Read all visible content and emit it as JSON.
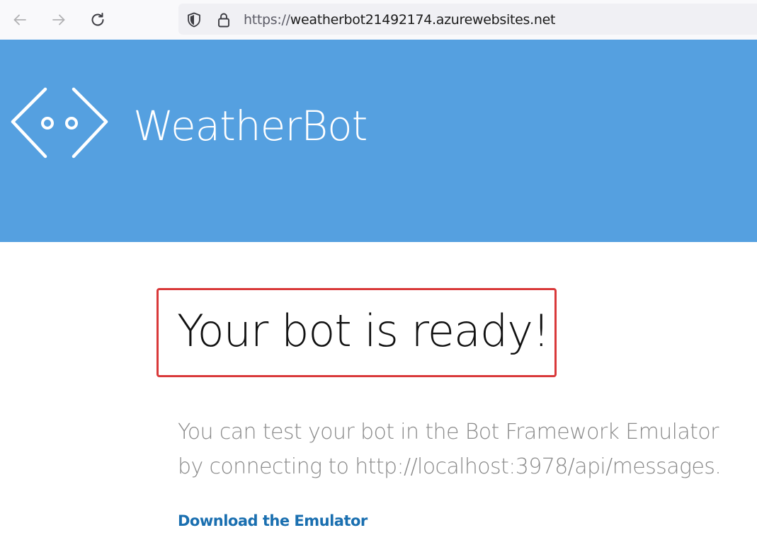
{
  "browser": {
    "url_scheme": "https://",
    "url_host": "weatherbot21492174.azurewebsites.net",
    "back_icon": "arrow-left-icon",
    "forward_icon": "arrow-right-icon",
    "reload_icon": "reload-icon",
    "tracking_icon": "shield-icon",
    "lock_icon": "lock-icon"
  },
  "header": {
    "bot_name": "WeatherBot",
    "logo_icon": "bot-face-icon",
    "background_color": "#55a0e0"
  },
  "main": {
    "title": "Your bot is ready!",
    "description_line1": "You can test your bot in the Bot Framework Emulator",
    "description_line2": "by connecting to http://localhost:3978/api/messages.",
    "download_link": "Download the Emulator",
    "highlight_color": "#d9393a",
    "link_color": "#1a6fb0"
  }
}
